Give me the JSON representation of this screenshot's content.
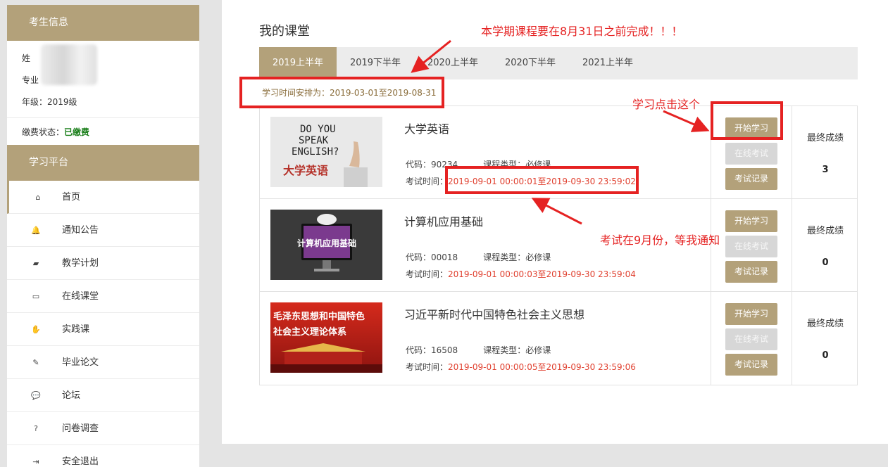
{
  "sidebar": {
    "student_header": "考生信息",
    "name_label": "姓",
    "major_label": "专业",
    "grade": "年级：2019级",
    "pay_label": "缴费状态：",
    "pay_status": "已缴费",
    "platform_header": "学习平台",
    "menu": [
      {
        "label": "首页",
        "icon": "home-icon",
        "glyph": "⌂"
      },
      {
        "label": "通知公告",
        "icon": "bell-icon",
        "glyph": "🔔"
      },
      {
        "label": "教学计划",
        "icon": "book-icon",
        "glyph": "▰"
      },
      {
        "label": "在线课堂",
        "icon": "monitor-icon",
        "glyph": "▭"
      },
      {
        "label": "实践课",
        "icon": "hand-icon",
        "glyph": "✋"
      },
      {
        "label": "毕业论文",
        "icon": "edit-icon",
        "glyph": "✎"
      },
      {
        "label": "论坛",
        "icon": "chat-icon",
        "glyph": "💬"
      },
      {
        "label": "问卷调查",
        "icon": "question-icon",
        "glyph": "?"
      },
      {
        "label": "安全退出",
        "icon": "logout-icon",
        "glyph": "⇥"
      }
    ]
  },
  "main": {
    "title": "我的课堂",
    "tabs": [
      "2019上半年",
      "2019下半年",
      "2020上半年",
      "2020下半年",
      "2021上半年"
    ],
    "schedule": "学习时间安排为：2019-03-01至2019-08-31",
    "courses": [
      {
        "name": "大学英语",
        "code": "代码：90234",
        "type": "课程类型：必修课",
        "exam_label": "考试时间：",
        "exam_time": "2019-09-01 00:00:01至2019-09-30 23:59:02",
        "thumb_lines": [
          "DO YOU",
          "SPEAK",
          "ENGLISH?"
        ],
        "thumb_caption": "大学英语",
        "score": "3"
      },
      {
        "name": "计算机应用基础",
        "code": "代码：00018",
        "type": "课程类型：必修课",
        "exam_label": "考试时间：",
        "exam_time": "2019-09-01 00:00:03至2019-09-30 23:59:04",
        "thumb_caption": "计算机应用基础",
        "score": "0"
      },
      {
        "name": "习近平新时代中国特色社会主义思想",
        "code": "代码：16508",
        "type": "课程类型：必修课",
        "exam_label": "考试时间：",
        "exam_time": "2019-09-01 00:00:05至2019-09-30 23:59:06",
        "thumb_lines": [
          "毛泽东思想和中国特色",
          "社会主义理论体系"
        ],
        "score": "0"
      }
    ],
    "buttons": {
      "start": "开始学习",
      "exam": "在线考试",
      "record": "考试记录"
    },
    "score_label": "最终成绩"
  },
  "annotations": {
    "deadline": "本学期课程要在8月31日之前完成！！！",
    "click_here": "学习点击这个",
    "exam_notice": "考试在9月份，等我通知"
  },
  "colors": {
    "accent": "#b3a17a",
    "annotation": "#e52222",
    "exam_time": "#e0402f",
    "paid": "#1b7f1b"
  }
}
